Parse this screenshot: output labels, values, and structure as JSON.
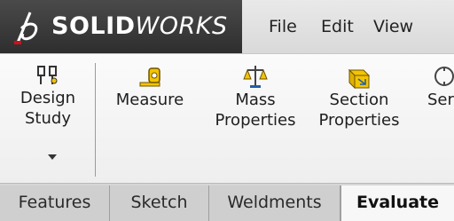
{
  "brand": {
    "bold": "SOLID",
    "italic": "WORKS"
  },
  "menu": [
    "File",
    "Edit",
    "View"
  ],
  "ribbon": {
    "design_study": {
      "line1": "Design",
      "line2": "Study"
    },
    "measure": {
      "line1": "Measure"
    },
    "mass_properties": {
      "line1": "Mass",
      "line2": "Properties"
    },
    "section_properties": {
      "line1": "Section",
      "line2": "Properties"
    },
    "partial": {
      "line1": "Ser"
    }
  },
  "tabs": [
    "Features",
    "Sketch",
    "Weldments",
    "Evaluate"
  ],
  "active_tab": "Evaluate",
  "colors": {
    "brand_bar": "#3a3a3a",
    "brand_accent": "#d20f1a",
    "icon_yellow": "#f4c400",
    "icon_blue": "#1f5fa8"
  }
}
